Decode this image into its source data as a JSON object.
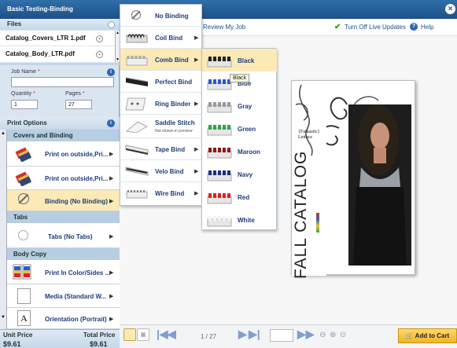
{
  "app": {
    "title": "Basic Testing-Binding",
    "close_icon": "close-icon"
  },
  "files": {
    "header": "Files",
    "items": [
      {
        "name": "Catalog_Covers_LTR 1.pdf"
      },
      {
        "name": "Catalog_Body_LTR.pdf"
      }
    ]
  },
  "job": {
    "name_label": "Job Name",
    "name_value": "",
    "quantity_label": "Quantity",
    "quantity_value": "1",
    "pages_label": "Pages",
    "pages_value": "27"
  },
  "print_options": {
    "header": "Print Options",
    "sections": [
      {
        "title": "Covers and Binding"
      },
      {
        "title": "Tabs"
      },
      {
        "title": "Body Copy"
      }
    ],
    "cover_items": [
      "Print on outside,Pri...",
      "Print on outside,Pri...",
      "Binding (No Binding)"
    ],
    "tab_items": [
      "Tabs (No Tabs)"
    ],
    "body_items": [
      "Print In Color/Sides ...",
      "Media (Standard W...",
      "Orientation (Portrait)"
    ]
  },
  "footer": {
    "unit_label": "Unit Price",
    "unit_value": "$9.61",
    "total_label": "Total Price",
    "total_value": "$9.61"
  },
  "toolbar": {
    "review": "Review My Job",
    "live_updates": "Turn Off Live Updates",
    "help": "Help"
  },
  "binding_menu": [
    "No Binding",
    "Coil Bind",
    "Comb Bind",
    "Perfect Bind",
    "Ring Binder",
    "Saddle Stitch",
    "Tape Bind",
    "Velo Bind",
    "Wire Bind"
  ],
  "saddle_note": "Not shown in preview",
  "color_menu": [
    "Black",
    "Blue",
    "Gray",
    "Green",
    "Maroon",
    "Navy",
    "Red",
    "White"
  ],
  "tooltip": "Black",
  "preview": {
    "catalog_text": "FALL CATALOG",
    "brand_text": "{Fantastic} Lettuce"
  },
  "pager": {
    "page": "1",
    "total": "/ 27",
    "page_text": "1 / 27"
  },
  "cart": {
    "label": "Add to Cart"
  },
  "colors": {
    "accent": "#1d5088",
    "cart": "#f0b428"
  }
}
